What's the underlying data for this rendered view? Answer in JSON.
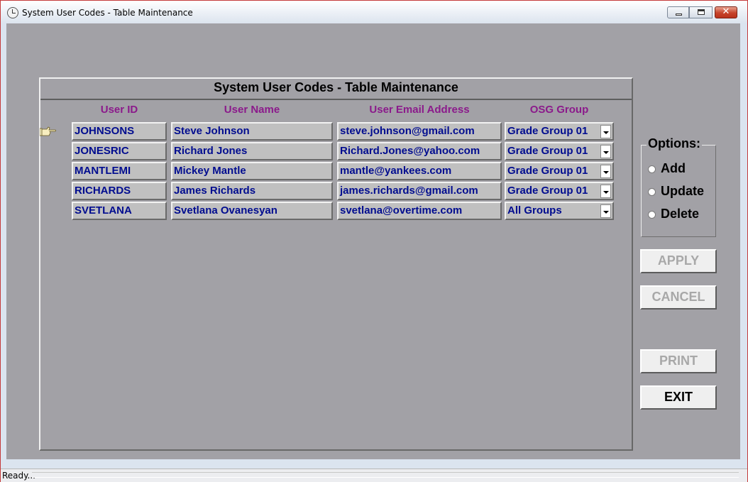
{
  "window": {
    "title": "System User Codes - Table Maintenance",
    "status_text": "Ready..."
  },
  "panel": {
    "title": "System User Codes - Table Maintenance",
    "columns": [
      "User ID",
      "User Name",
      "User Email Address",
      "OSG Group"
    ],
    "rows": [
      {
        "user_id": "JOHNSONS",
        "user_name": "Steve Johnson",
        "email": "steve.johnson@gmail.com",
        "group": "Grade Group 01"
      },
      {
        "user_id": "JONESRIC",
        "user_name": "Richard Jones",
        "email": "Richard.Jones@yahoo.com",
        "group": "Grade Group 01"
      },
      {
        "user_id": "MANTLEMI",
        "user_name": "Mickey Mantle",
        "email": "mantle@yankees.com",
        "group": "Grade Group 01"
      },
      {
        "user_id": "RICHARDS",
        "user_name": "James Richards",
        "email": "james.richards@gmail.com",
        "group": "Grade Group 01"
      },
      {
        "user_id": "SVETLANA",
        "user_name": "Svetlana Ovanesyan",
        "email": "svetlana@overtime.com",
        "group": "All Groups"
      }
    ]
  },
  "options": {
    "legend": "Options:",
    "items": [
      "Add",
      "Update",
      "Delete"
    ]
  },
  "buttons": {
    "apply": "APPLY",
    "cancel": "CANCEL",
    "print": "PRINT",
    "exit": "EXIT"
  },
  "colors": {
    "header_text": "#8b1a8b",
    "cell_text": "#000c8f",
    "panel_bg": "#a2a1a6"
  }
}
